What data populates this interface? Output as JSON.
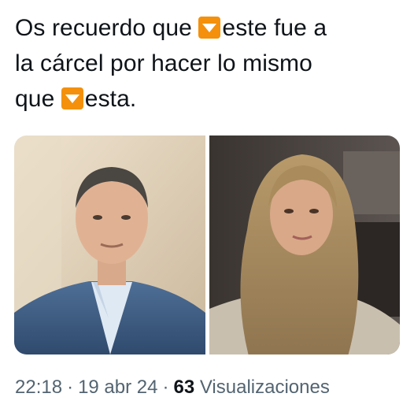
{
  "tweet": {
    "line1_part1": "Os recuerdo que ",
    "line1_part2": "este fue a",
    "line2": "la cárcel por hacer lo mismo",
    "line3_part1": "que ",
    "line3_part2": "esta.",
    "inline_icon": "down-arrow-orange-icon"
  },
  "media": {
    "images": [
      {
        "name": "man-in-blue-suit-photo"
      },
      {
        "name": "woman-with-long-hair-photo"
      }
    ]
  },
  "meta": {
    "time": "22:18",
    "separator": "·",
    "date": "19 abr 24",
    "view_count": "63",
    "views_label": "Visualizaciones"
  },
  "colors": {
    "text": "#0f1419",
    "muted": "#536471",
    "icon_bg": "#f4900c"
  }
}
